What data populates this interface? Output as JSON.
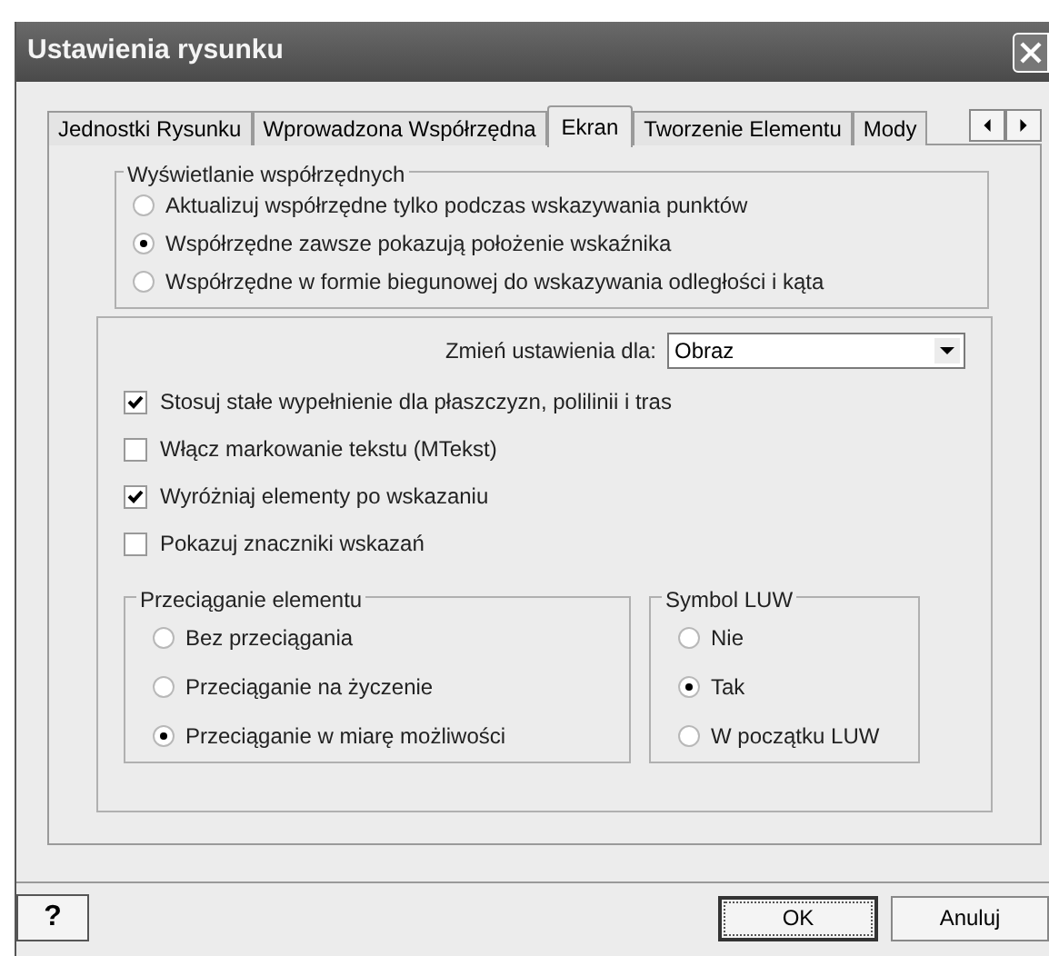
{
  "window": {
    "title": "Ustawienia rysunku"
  },
  "tabs": [
    {
      "label": "Jednostki Rysunku",
      "selected": false
    },
    {
      "label": "Wprowadzona Współrzędna",
      "selected": false
    },
    {
      "label": "Ekran",
      "selected": true
    },
    {
      "label": "Tworzenie Elementu",
      "selected": false
    },
    {
      "label": "Mody",
      "selected": false
    }
  ],
  "coordinates": {
    "title": "Wyświetlanie współrzędnych",
    "options": [
      {
        "label": "Aktualizuj współrzędne tylko podczas wskazywania punktów",
        "selected": false
      },
      {
        "label": "Współrzędne zawsze pokazują położenie wskaźnika",
        "selected": true
      },
      {
        "label": "Współrzędne w formie biegunowej do wskazywania odległości i kąta",
        "selected": false
      }
    ]
  },
  "settings_for": {
    "label": "Zmień ustawienia dla:",
    "value": "Obraz"
  },
  "checkboxes": [
    {
      "label": "Stosuj stałe wypełnienie dla płaszczyzn, polilinii i tras",
      "checked": true
    },
    {
      "label": "Włącz markowanie tekstu (MTekst)",
      "checked": false
    },
    {
      "label": "Wyróżniaj elementy po wskazaniu",
      "checked": true
    },
    {
      "label": "Pokazuj znaczniki wskazań",
      "checked": false
    }
  ],
  "element_drag": {
    "title": "Przeciąganie elementu",
    "options": [
      {
        "label": "Bez przeciągania",
        "selected": false
      },
      {
        "label": "Przeciąganie na życzenie",
        "selected": false
      },
      {
        "label": "Przeciąganie w miarę możliwości",
        "selected": true
      }
    ]
  },
  "ucs_symbol": {
    "title": "Symbol LUW",
    "options": [
      {
        "label": "Nie",
        "selected": false
      },
      {
        "label": "Tak",
        "selected": true
      },
      {
        "label": "W początku LUW",
        "selected": false
      }
    ]
  },
  "buttons": {
    "help": "?",
    "ok": "OK",
    "cancel": "Anuluj"
  }
}
